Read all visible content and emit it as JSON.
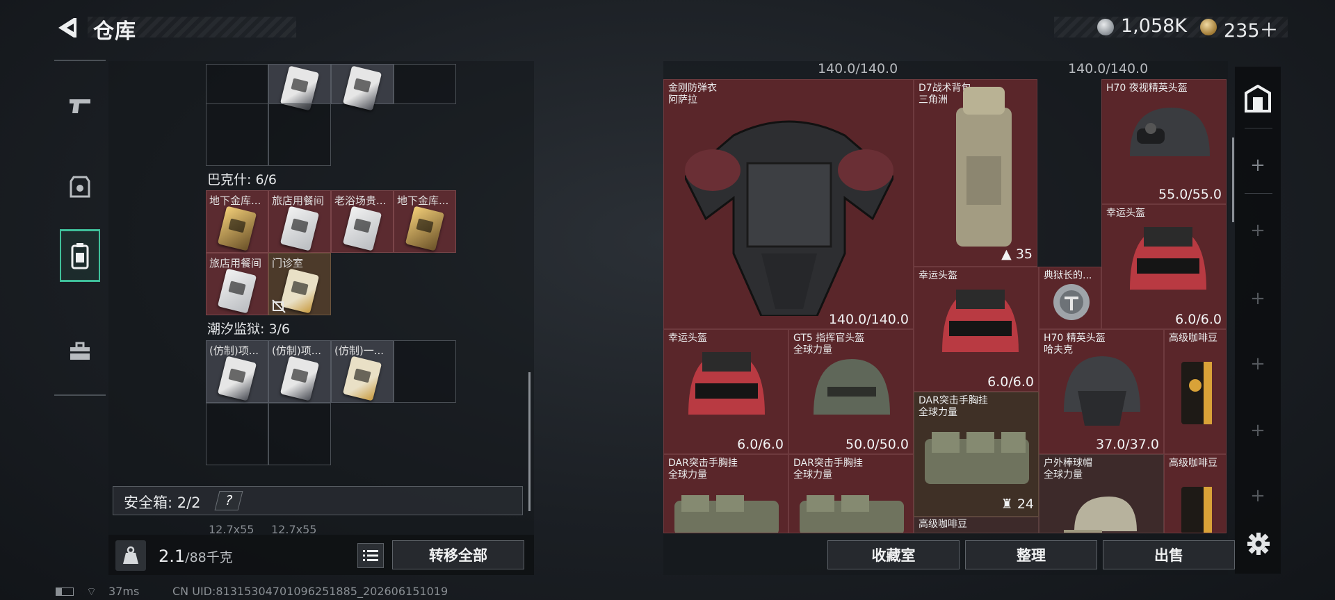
{
  "header": {
    "title": "仓库",
    "currency_silver": "1,058K",
    "currency_gold": "235＋"
  },
  "left": {
    "sections": [
      {
        "title": "巴克什: 6/6"
      },
      {
        "title": "潮汐监狱: 3/6"
      }
    ],
    "bakshi_items": [
      "地下金库...",
      "旅店用餐间",
      "老浴场贵...",
      "地下金库...",
      "旅店用餐间",
      "门诊室"
    ],
    "prison_items": [
      "(仿制)项...",
      "(仿制)项...",
      "(仿制)一..."
    ],
    "safebox_label": "安全箱: 2/2",
    "help": "?",
    "ammo_labels": [
      "12.7x55",
      "12.7x55"
    ],
    "weight_value": "2.1",
    "weight_unit": "/88千克",
    "transfer_all": "转移全部"
  },
  "right": {
    "top_durability": [
      "140.0/140.0",
      "140.0/140.0"
    ],
    "slots": [
      {
        "name": "金刚防弹衣\n阿萨拉",
        "dura": "140.0/140.0"
      },
      {
        "name": "D7战术背包\n三角洲",
        "count": "35"
      },
      {
        "name": "H70 夜视精英头盔",
        "dura": "55.0/55.0"
      },
      {
        "name": "幸运头盔",
        "dura": "6.0/6.0"
      },
      {
        "name": "典狱长的...",
        "dura": ""
      },
      {
        "name": "幸运头盔",
        "dura": "6.0/6.0"
      },
      {
        "name": "幸运头盔",
        "dura": "6.0/6.0"
      },
      {
        "name": "GT5 指挥官头盔\n全球力量",
        "dura": "50.0/50.0"
      },
      {
        "name": "DAR突击手胸挂\n全球力量",
        "count": "24"
      },
      {
        "name": "H70 精英头盔\n哈夫克",
        "dura": "37.0/37.0"
      },
      {
        "name": "高级咖啡豆"
      },
      {
        "name": "DAR突击手胸挂\n全球力量"
      },
      {
        "name": "DAR突击手胸挂\n全球力量"
      },
      {
        "name": "高级咖啡豆"
      },
      {
        "name": "户外棒球帽\n全球力量"
      },
      {
        "name": "高级咖啡豆"
      }
    ],
    "buttons": {
      "collection": "收藏室",
      "sort": "整理",
      "sell": "出售"
    }
  },
  "status": {
    "ping": "37ms",
    "uid": "CN UID:8131530470109625188­5_202606151019"
  },
  "colors": {
    "accent": "#3fbf9a",
    "slot_red": "#5a262a"
  },
  "icons": [
    "back-arrow-icon",
    "silver-coin-icon",
    "gold-coin-icon",
    "gun-icon",
    "armor-icon",
    "backpack-icon",
    "briefcase-icon",
    "weight-icon",
    "list-icon",
    "gear-icon",
    "locker-icon"
  ]
}
